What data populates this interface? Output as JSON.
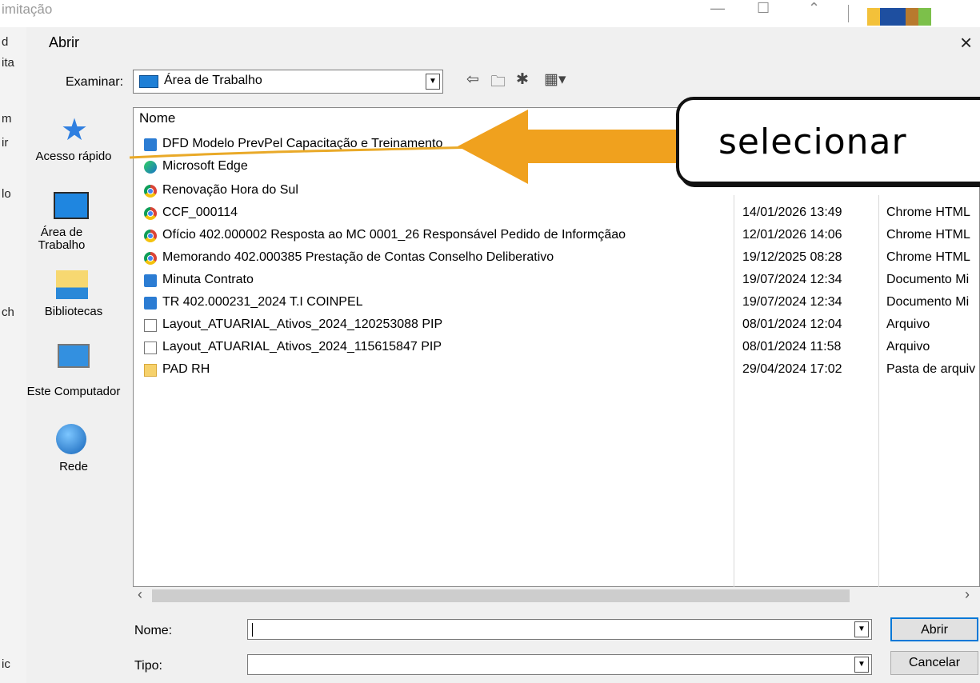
{
  "background_window": {
    "title": "imitação",
    "left_strip_chars": [
      "d",
      "ita",
      "m",
      "ir",
      "lo",
      "ch",
      "ic"
    ]
  },
  "dialog": {
    "title": "Abrir",
    "close_glyph": "×",
    "examinar": {
      "label": "Examinar:",
      "value": "Área de Trabalho"
    },
    "places": [
      {
        "label": "Acesso rápido",
        "icon": "star-icon"
      },
      {
        "label": "Área de Trabalho",
        "icon": "desktop-icon"
      },
      {
        "label": "Bibliotecas",
        "icon": "library-icon"
      },
      {
        "label": "Este Computador",
        "icon": "computer-icon"
      },
      {
        "label": "Rede",
        "icon": "network-icon"
      }
    ],
    "list": {
      "header_name": "Nome",
      "rows": [
        {
          "name": "DFD Modelo PrevPel Capacitação e Treinamento",
          "date": "",
          "type": "",
          "icon": "doc-icon"
        },
        {
          "name": "Microsoft Edge",
          "date": "",
          "type": "",
          "icon": "edge-icon"
        },
        {
          "name": "Renovação Hora do Sul",
          "date": "",
          "type": "",
          "icon": "chrome-icon"
        },
        {
          "name": "CCF_000114",
          "date": "14/01/2026 13:49",
          "type": "Chrome HTML",
          "icon": "chrome-icon"
        },
        {
          "name": "Ofício 402.000002 Resposta ao MC 0001_26 Responsável Pedido de Informçãao",
          "date": "12/01/2026 14:06",
          "type": "Chrome HTML",
          "icon": "chrome-icon"
        },
        {
          "name": "Memorando 402.000385 Prestação de Contas Conselho Deliberativo",
          "date": "19/12/2025 08:28",
          "type": "Chrome HTML",
          "icon": "chrome-icon"
        },
        {
          "name": "Minuta Contrato",
          "date": "19/07/2024 12:34",
          "type": "Documento Mi",
          "icon": "doc-icon"
        },
        {
          "name": "TR 402.000231_2024 T.I COINPEL",
          "date": "19/07/2024 12:34",
          "type": "Documento Mi",
          "icon": "doc-icon"
        },
        {
          "name": "Layout_ATUARIAL_Ativos_2024_120253088 PIP",
          "date": "08/01/2024 12:04",
          "type": "Arquivo",
          "icon": "blank-file-icon"
        },
        {
          "name": "Layout_ATUARIAL_Ativos_2024_115615847 PIP",
          "date": "08/01/2024 11:58",
          "type": "Arquivo",
          "icon": "blank-file-icon"
        },
        {
          "name": "PAD RH",
          "date": "29/04/2024 17:02",
          "type": "Pasta de arquiv",
          "icon": "folder-icon"
        }
      ]
    },
    "nome_label": "Nome:",
    "nome_value": "",
    "tipo_label": "Tipo:",
    "tipo_value": "",
    "open_button": "Abrir",
    "cancel_button": "Cancelar"
  },
  "annotation": {
    "text": "selecionar",
    "arrow_color": "#f0a11e",
    "underline_color": "#e9a928"
  }
}
